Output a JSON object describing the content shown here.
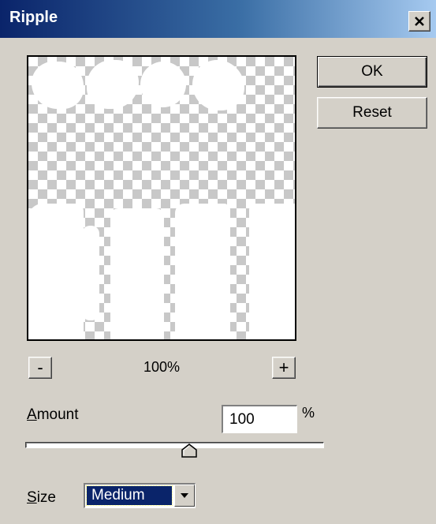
{
  "window": {
    "title": "Ripple",
    "close_glyph": "✕"
  },
  "buttons": {
    "ok": "OK",
    "reset": "Reset"
  },
  "zoom": {
    "minus": "-",
    "plus": "+",
    "level": "100%"
  },
  "amount": {
    "label_accel": "A",
    "label_rest": "mount",
    "value": "100",
    "unit": "%",
    "slider_fraction": 0.55
  },
  "size": {
    "label_accel": "S",
    "label_rest": "ize",
    "selected": "Medium"
  },
  "colors": {
    "title_start": "#0a246a",
    "title_end": "#a6caf0",
    "face": "#d4d0c8",
    "selection": "#0a246a"
  }
}
